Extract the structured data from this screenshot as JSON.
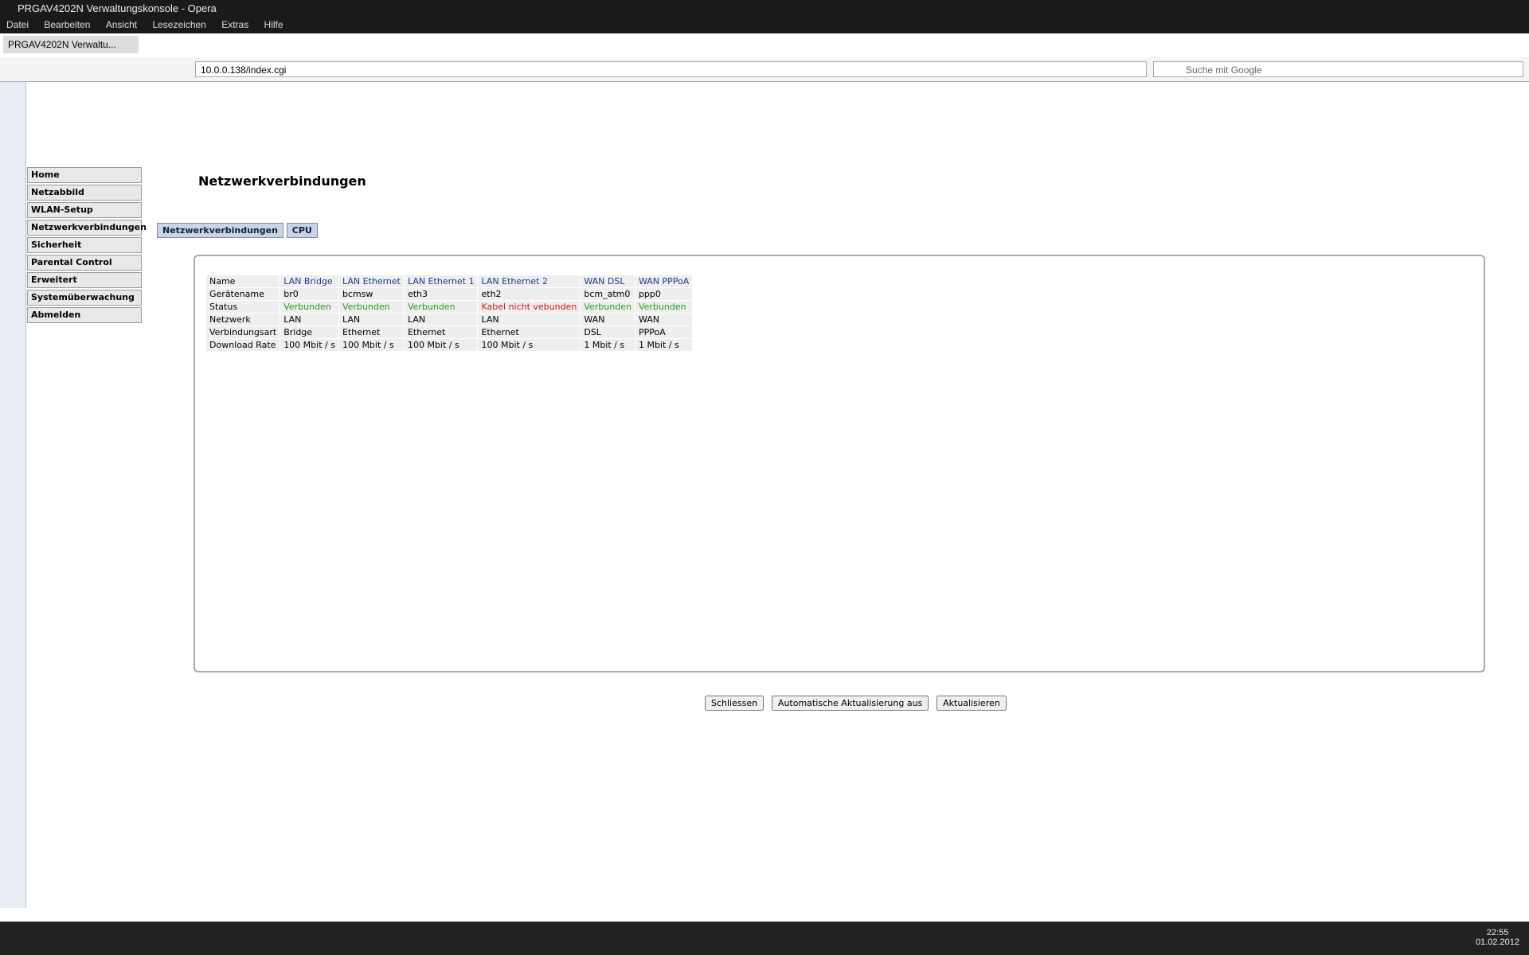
{
  "window": {
    "title": "PRGAV4202N Verwaltungskonsole - Opera"
  },
  "menu": [
    "Datei",
    "Bearbeiten",
    "Ansicht",
    "Lesezeichen",
    "Extras",
    "Hilfe"
  ],
  "tab": {
    "label": "PRGAV4202N Verwaltu..."
  },
  "address": {
    "scheme": "Web",
    "url": "10.0.0.138/index.cgi",
    "search_placeholder": "Suche mit Google"
  },
  "sidebar": [
    "Home",
    "Netzabbild",
    "WLAN-Setup",
    "Netzwerkverbindungen",
    "Sicherheit",
    "Parental Control",
    "Erweitert",
    "Systemüberwachung",
    "Abmelden"
  ],
  "page_title": "Netzwerkverbindungen",
  "tabs": [
    "Netzwerkverbindungen",
    "CPU"
  ],
  "columns": [
    "Name",
    "LAN Bridge",
    "LAN Ethernet",
    "LAN Ethernet 1",
    "LAN Ethernet 2",
    "WAN DSL",
    "WAN PPPoA"
  ],
  "rows": [
    [
      "Gerätename",
      "br0",
      "bcmsw",
      "eth3",
      "eth2",
      "bcm_atm0",
      "ppp0"
    ],
    [
      "Status",
      "Verbunden",
      "Verbunden",
      "Verbunden",
      "Kabel nicht vebunden",
      "Verbunden",
      "Verbunden"
    ],
    [
      "Netzwerk",
      "LAN",
      "LAN",
      "LAN",
      "LAN",
      "WAN",
      "WAN"
    ],
    [
      "Verbindungsart",
      "Bridge",
      "Ethernet",
      "Ethernet",
      "Ethernet",
      "DSL",
      "PPPoA"
    ],
    [
      "Download Rate",
      "100 Mbit / s",
      "100 Mbit / s",
      "100 Mbit / s",
      "100 Mbit / s",
      "1 Mbit / s",
      "1 Mbit / s"
    ]
  ],
  "buttons": [
    "Schliessen",
    "Automatische Aktualisierung aus",
    "Aktualisieren"
  ],
  "clock": {
    "time": "22:55",
    "date": "01.02.2012"
  }
}
